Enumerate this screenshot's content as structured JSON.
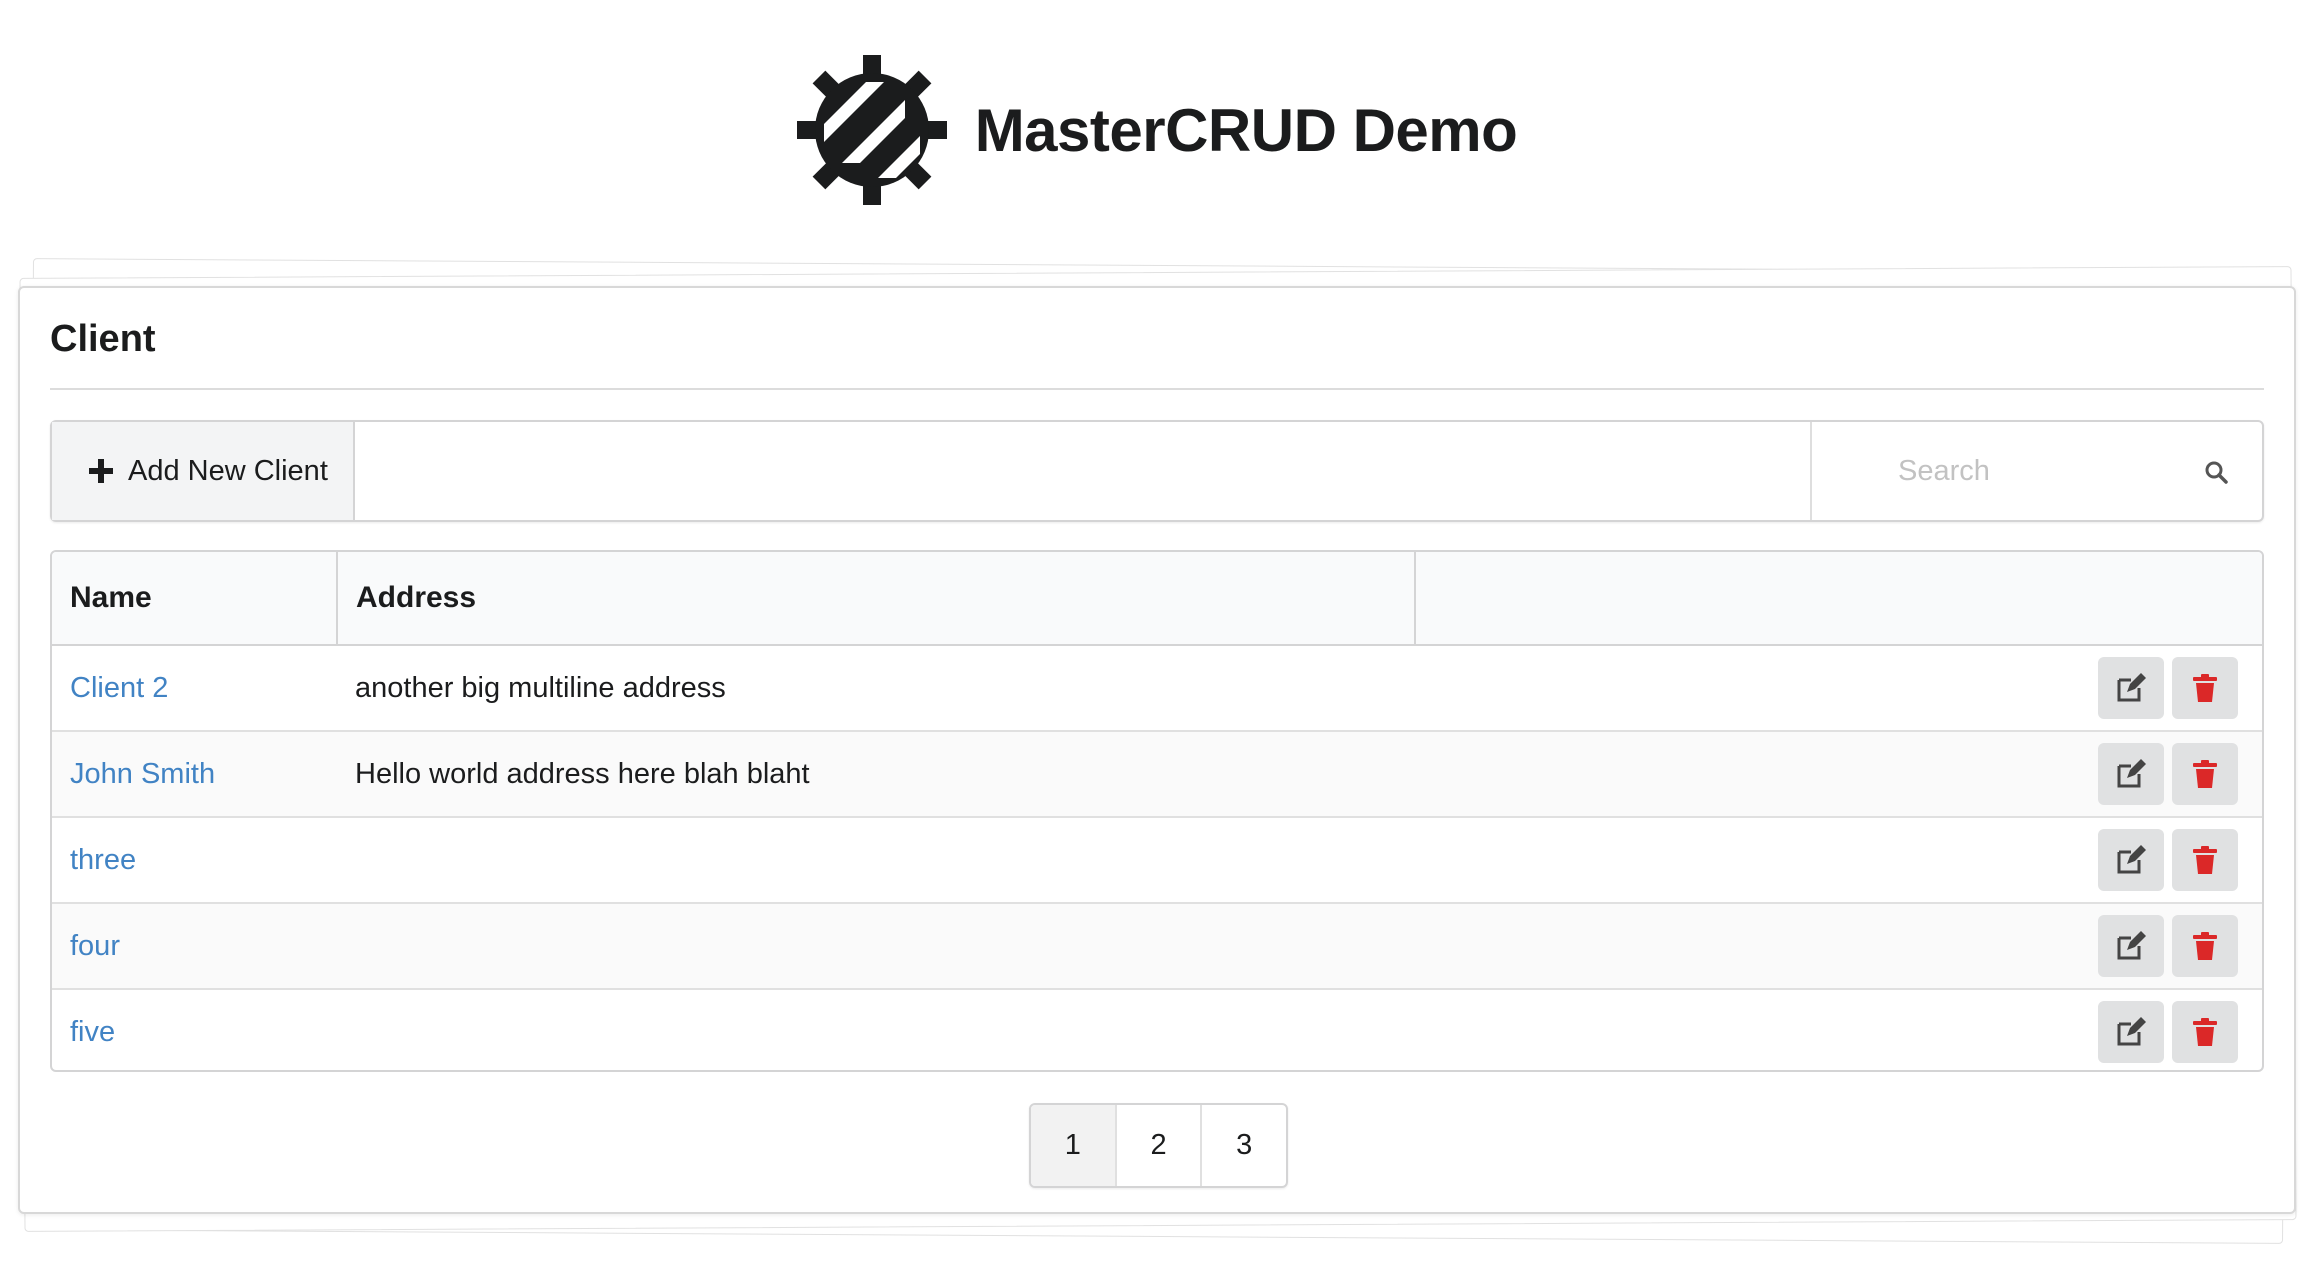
{
  "header": {
    "title": "MasterCRUD Demo",
    "logo_icon": "gear-crud-logo-icon"
  },
  "card": {
    "title": "Client"
  },
  "toolbar": {
    "add_label": "Add New Client",
    "add_icon": "plus-icon",
    "search_placeholder": "Search",
    "search_value": "",
    "search_icon": "search-icon"
  },
  "table": {
    "columns": [
      "Name",
      "Address",
      ""
    ],
    "rows": [
      {
        "name": "Client 2",
        "address": "another big multiline address"
      },
      {
        "name": "John Smith",
        "address": "Hello world address here blah blaht"
      },
      {
        "name": "three",
        "address": ""
      },
      {
        "name": "four",
        "address": ""
      },
      {
        "name": "five",
        "address": ""
      }
    ],
    "edit_icon": "edit-icon",
    "delete_icon": "trash-icon"
  },
  "pagination": {
    "pages": [
      "1",
      "2",
      "3"
    ],
    "active": "1"
  },
  "colors": {
    "link": "#4183c4",
    "delete": "#db2828",
    "button_bg": "#e0e1e2"
  }
}
